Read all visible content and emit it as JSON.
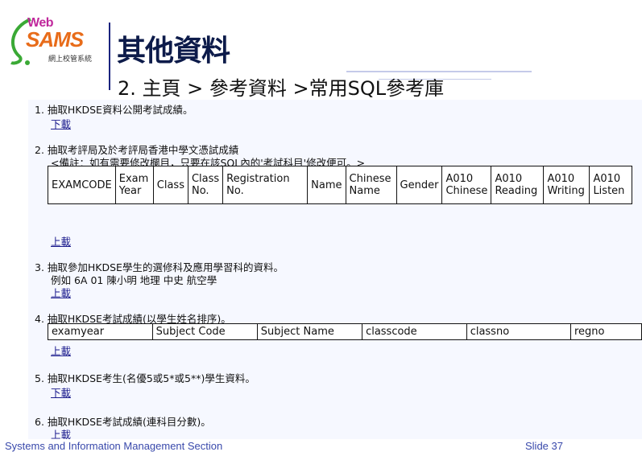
{
  "logo": {
    "web": "Web",
    "sams": "SAMS",
    "sub": "網上校管系統"
  },
  "header": {
    "title": "其他資料",
    "breadcrumb": "2. 主頁 > 參考資料 >常用SQL參考庫"
  },
  "items": [
    {
      "label": "1. 抽取HKDSE資料公開考試成績。",
      "link": "下載"
    },
    {
      "label": "2. 抽取考評局及於考評局香港中學文憑試成績",
      "note": "<備註：如有需要修改欄目，只要在該SQL內的'考試科目'修改便可。>",
      "link": "上載"
    },
    {
      "label": "3. 抽取參加HKDSE學生的選修科及應用學習科的資料。",
      "note": "例如 6A 01 陳小明 地理 中史 航空學",
      "link": "上載"
    },
    {
      "label": "4. 抽取HKDSE考試成績(以學生姓名排序)。",
      "link": "上載"
    },
    {
      "label": "5. 抽取HKDSE考生(名優5或5*或5**)學生資料。",
      "link": "下載"
    },
    {
      "label": "6. 抽取HKDSE考試成績(連科目分數)。",
      "link": "上載"
    }
  ],
  "table2": [
    "EXAMCODE",
    "Exam Year",
    "Class",
    "Class No.",
    "Registration No.",
    "Name",
    "Chinese Name",
    "Gender",
    "A010 Chinese",
    "A010 Reading",
    "A010 Writing",
    "A010 Listen"
  ],
  "table4": [
    "examyear",
    "Subject Code",
    "Subject Name",
    "classcode",
    "classno",
    "regno"
  ],
  "footer": {
    "section": "Systems and Information Management Section",
    "slide": "Slide 37"
  }
}
